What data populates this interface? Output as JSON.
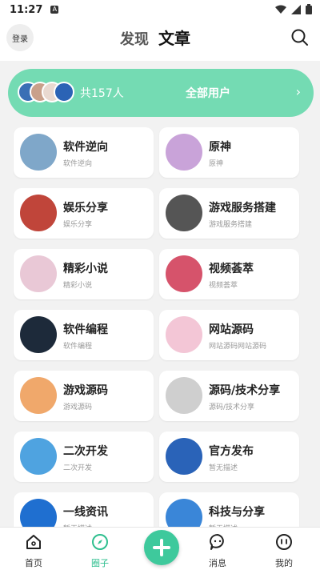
{
  "status": {
    "time": "11:27",
    "notif_letter": "A"
  },
  "header": {
    "login_label": "登录",
    "tabs": [
      {
        "label": "发现"
      },
      {
        "label": "文章"
      }
    ],
    "active_tab": "文章"
  },
  "users": {
    "count_text": "共157人",
    "all_label": "全部用户"
  },
  "categories": [
    {
      "title": "软件逆向",
      "desc": "软件逆向",
      "icon": "lock-icon",
      "color": "#7fa7c9"
    },
    {
      "title": "原神",
      "desc": "原神",
      "icon": "anime-image",
      "color": "#c9a3d9"
    },
    {
      "title": "娱乐分享",
      "desc": "娱乐分享",
      "icon": "collage-image",
      "color": "#c0453a"
    },
    {
      "title": "游戏服务搭建",
      "desc": "游戏服务搭建",
      "icon": "banner-image",
      "color": "#555555"
    },
    {
      "title": "精彩小说",
      "desc": "精彩小说",
      "icon": "girl-image",
      "color": "#e9c8d6"
    },
    {
      "title": "视频荟萃",
      "desc": "视频荟萃",
      "icon": "flower-image",
      "color": "#d6536b"
    },
    {
      "title": "软件编程",
      "desc": "软件编程",
      "icon": "code-image",
      "color": "#1d2a3a"
    },
    {
      "title": "网站源码",
      "desc": "网站源码网站源码",
      "icon": "web-image",
      "color": "#f3c6d6"
    },
    {
      "title": "游戏源码",
      "desc": "游戏源码",
      "icon": "game-image",
      "color": "#f0a86b"
    },
    {
      "title": "源码/技术分享",
      "desc": "源码/技术分享",
      "icon": "doc-image",
      "color": "#cfcfcf"
    },
    {
      "title": "二次开发",
      "desc": "二次开发",
      "icon": "dev-image",
      "color": "#4fa3e0"
    },
    {
      "title": "官方发布",
      "desc": "暂无描述",
      "icon": "logo-image",
      "color": "#2a63b8"
    },
    {
      "title": "一线资讯",
      "desc": "暂无描述",
      "icon": "news-image",
      "color": "#1f6fd0"
    },
    {
      "title": "科技与分享",
      "desc": "暂无描述",
      "icon": "tech-image",
      "color": "#3a86d8"
    }
  ],
  "nav": [
    {
      "label": "首页",
      "icon": "home-icon"
    },
    {
      "label": "圈子",
      "icon": "compass-icon"
    },
    {
      "label": "消息",
      "icon": "message-icon"
    },
    {
      "label": "我的",
      "icon": "profile-icon"
    }
  ],
  "colors": {
    "accent": "#3ec99c",
    "banner": "#74dbb3",
    "active_nav": "#2fbf8f"
  }
}
